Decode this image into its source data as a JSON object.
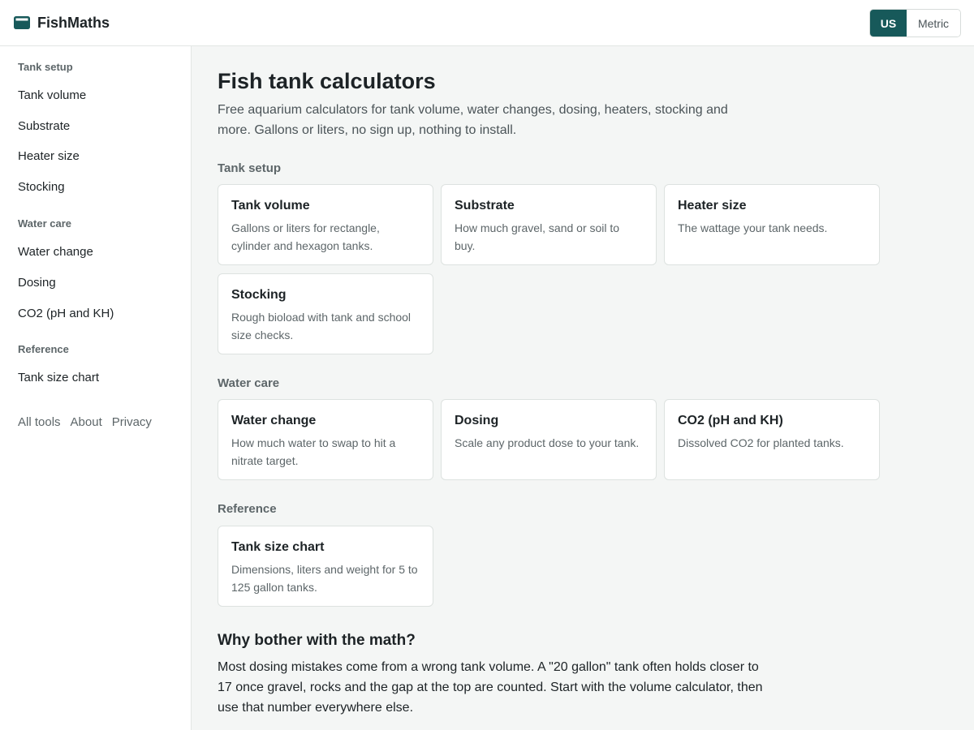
{
  "app": {
    "name": "FishMaths",
    "icon": "tank-icon",
    "accent_color": "#17595a"
  },
  "unit_toggle": {
    "options": [
      "US",
      "Metric"
    ],
    "selected": "US"
  },
  "sidebar": {
    "groups": [
      {
        "heading": "Tank setup",
        "items": [
          "Tank volume",
          "Substrate",
          "Heater size",
          "Stocking"
        ]
      },
      {
        "heading": "Water care",
        "items": [
          "Water change",
          "Dosing",
          "CO2 (pH and KH)"
        ]
      },
      {
        "heading": "Reference",
        "items": [
          "Tank size chart"
        ]
      }
    ],
    "footer_links": [
      "All tools",
      "About",
      "Privacy"
    ]
  },
  "main": {
    "title": "Fish tank calculators",
    "intro": "Free aquarium calculators for tank volume, water changes, dosing, heaters, stocking and more. Gallons or liters, no sign up, nothing to install.",
    "sections": [
      {
        "label": "Tank setup",
        "cards": [
          {
            "title": "Tank volume",
            "desc": "Gallons or liters for rectangle, cylinder and hexagon tanks."
          },
          {
            "title": "Substrate",
            "desc": "How much gravel, sand or soil to buy."
          },
          {
            "title": "Heater size",
            "desc": "The wattage your tank needs."
          },
          {
            "title": "Stocking",
            "desc": "Rough bioload with tank and school size checks."
          }
        ]
      },
      {
        "label": "Water care",
        "cards": [
          {
            "title": "Water change",
            "desc": "How much water to swap to hit a nitrate target."
          },
          {
            "title": "Dosing",
            "desc": "Scale any product dose to your tank."
          },
          {
            "title": "CO2 (pH and KH)",
            "desc": "Dissolved CO2 for planted tanks."
          }
        ]
      },
      {
        "label": "Reference",
        "cards": [
          {
            "title": "Tank size chart",
            "desc": "Dimensions, liters and weight for 5 to 125 gallon tanks."
          }
        ]
      }
    ],
    "why": {
      "title": "Why bother with the math?",
      "body": "Most dosing mistakes come from a wrong tank volume. A \"20 gallon\" tank often holds closer to 17 once gravel, rocks and the gap at the top are counted. Start with the volume calculator, then use that number everywhere else."
    }
  }
}
